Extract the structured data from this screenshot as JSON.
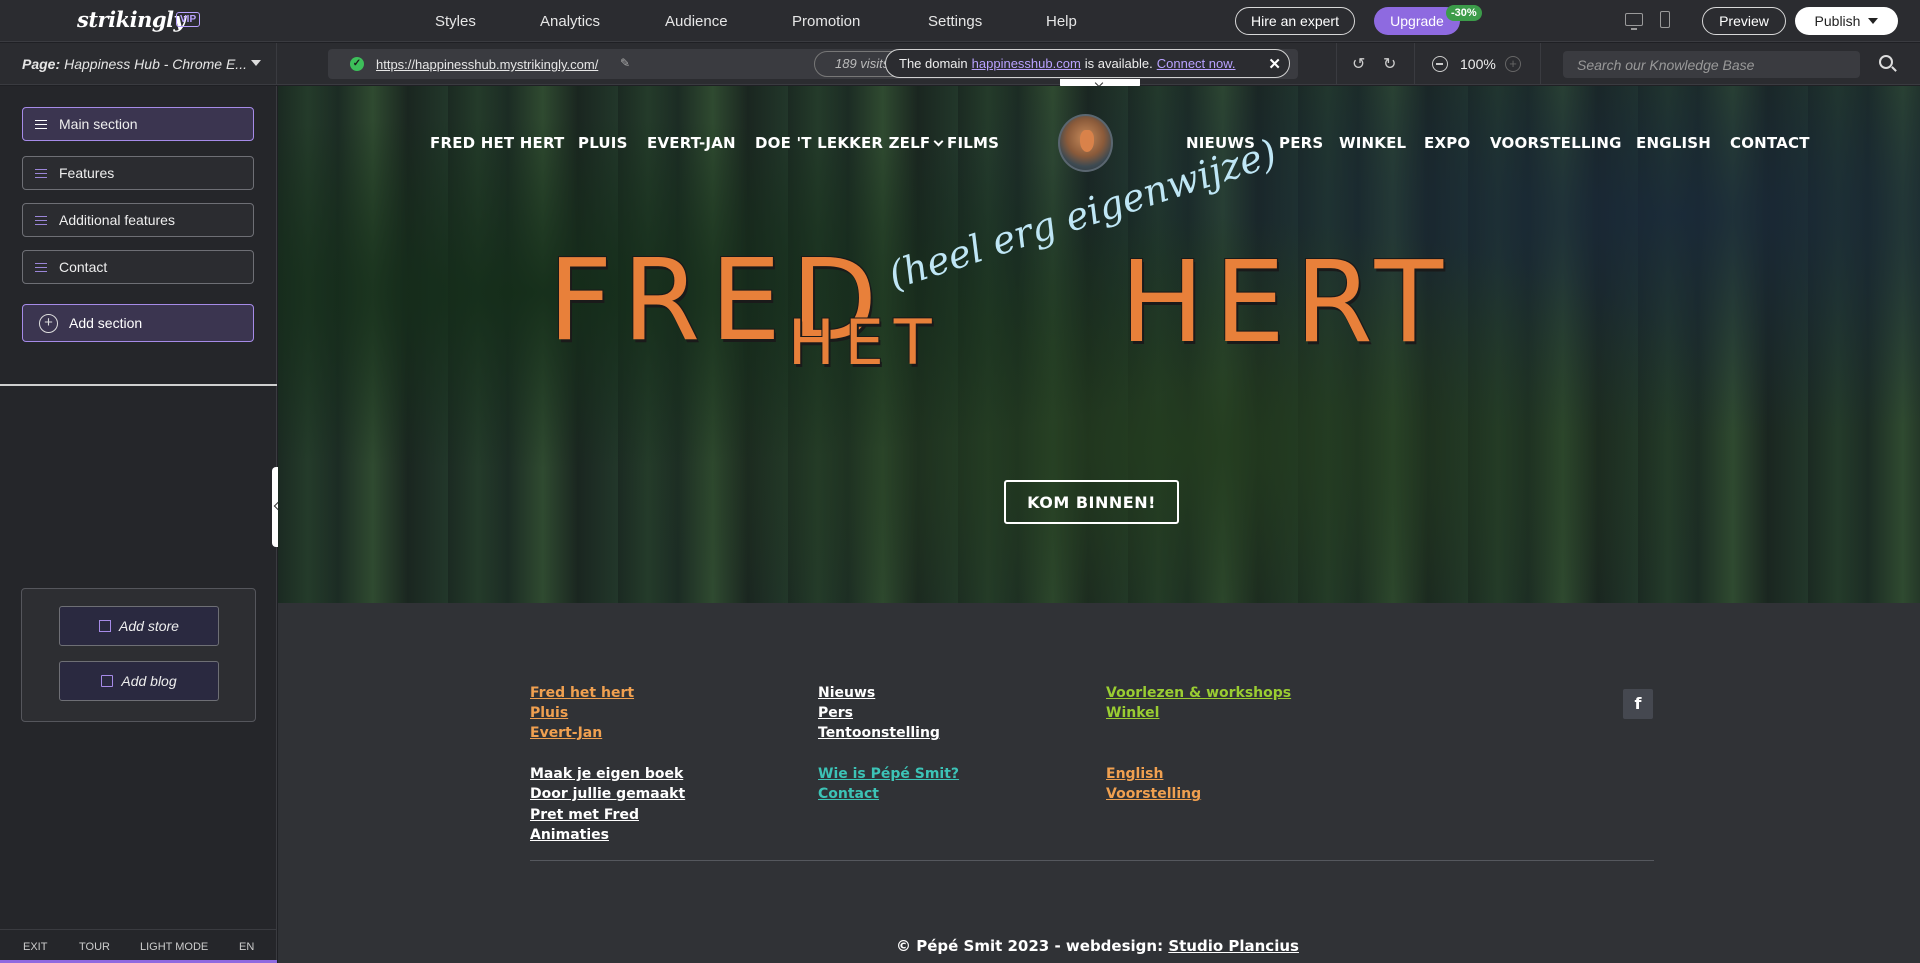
{
  "app": {
    "logo": "strikingly",
    "vip_badge": "VIP",
    "nav": [
      "Styles",
      "Analytics",
      "Audience",
      "Promotion",
      "Settings",
      "Help"
    ],
    "hire_label": "Hire an expert",
    "upgrade_label": "Upgrade",
    "discount_badge": "-30%",
    "preview_label": "Preview",
    "publish_label": "Publish"
  },
  "subbar": {
    "page_prefix": "Page:",
    "page_name": "Happiness Hub - Chrome E...",
    "url": "https://happinesshub.mystrikingly.com/",
    "visits": "189 visits",
    "domain_notice": {
      "prefix": "The domain",
      "domain": "happinesshub.com",
      "middle": "is available.",
      "action": "Connect now."
    },
    "zoom": "100%",
    "search_placeholder": "Search our Knowledge Base"
  },
  "sidebar": {
    "sections": [
      "Main section",
      "Features",
      "Additional features",
      "Contact"
    ],
    "add_section_label": "Add section",
    "add_store_label": "Add store",
    "add_blog_label": "Add blog",
    "footer": [
      "EXIT",
      "TOUR",
      "LIGHT MODE",
      "EN"
    ]
  },
  "site": {
    "nav_left": [
      "FRED HET HERT",
      "PLUIS",
      "EVERT-JAN",
      "DOE 'T LEKKER ZELF",
      "FILMS"
    ],
    "nav_right": [
      "NIEUWS",
      "PERS",
      "WINKEL",
      "EXPO",
      "VOORSTELLING",
      "ENGLISH",
      "CONTACT"
    ],
    "title_fred": "FRED",
    "title_het": "HET",
    "title_hert": "HERT",
    "script": "(heel erg eigenwijze)",
    "cta_label": "KOM BINNEN!",
    "footer_links": {
      "col1a": [
        "Fred het hert",
        "Pluis",
        "Evert-Jan"
      ],
      "col1b": [
        "Maak je eigen boek",
        "Door jullie gemaakt",
        "Pret met Fred",
        "Animaties"
      ],
      "col2a": [
        "Nieuws",
        "Pers",
        "Tentoonstelling"
      ],
      "col2b": [
        "Wie is Pépé Smit?",
        "Contact"
      ],
      "col3a": [
        "Voorlezen & workshops",
        "Winkel"
      ],
      "col3b": [
        "English",
        "Voorstelling"
      ]
    },
    "copyright_prefix": "© Pépé Smit 2023  -  webdesign:",
    "copyright_link": "Studio Plancius",
    "facebook_glyph": "f"
  },
  "colors": {
    "accent": "#8e6ae0",
    "footer_orange": "#f0a050",
    "footer_green": "#9acd32",
    "footer_teal": "#3cc3b6"
  }
}
